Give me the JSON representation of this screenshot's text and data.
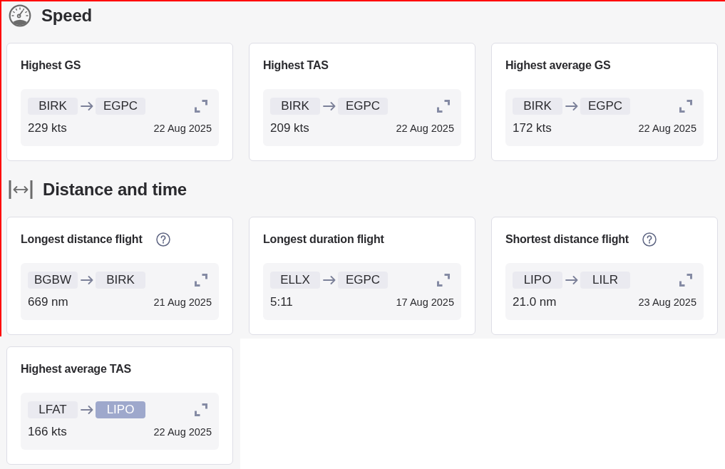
{
  "sections": [
    {
      "kind": "speed",
      "title": "Speed",
      "cards": [
        {
          "title": "Highest GS",
          "help": false,
          "route": [
            {
              "code": "BIRK",
              "highlighted": false
            },
            {
              "code": "EGPC",
              "highlighted": false
            }
          ],
          "value": "229 kts",
          "date": "22 Aug 2025"
        },
        {
          "title": "Highest TAS",
          "help": false,
          "route": [
            {
              "code": "BIRK",
              "highlighted": false
            },
            {
              "code": "EGPC",
              "highlighted": false
            }
          ],
          "value": "209 kts",
          "date": "22 Aug 2025"
        },
        {
          "title": "Highest average GS",
          "help": false,
          "route": [
            {
              "code": "BIRK",
              "highlighted": false
            },
            {
              "code": "EGPC",
              "highlighted": false
            }
          ],
          "value": "172 kts",
          "date": "22 Aug 2025"
        }
      ]
    },
    {
      "kind": "distance",
      "title": "Distance and time",
      "cards": [
        {
          "title": "Longest distance flight",
          "help": true,
          "route": [
            {
              "code": "BGBW",
              "highlighted": false
            },
            {
              "code": "BIRK",
              "highlighted": false
            }
          ],
          "value": "669 nm",
          "date": "21 Aug 2025"
        },
        {
          "title": "Longest duration flight",
          "help": false,
          "route": [
            {
              "code": "ELLX",
              "highlighted": false
            },
            {
              "code": "EGPC",
              "highlighted": false
            }
          ],
          "value": "5:11",
          "date": "17 Aug 2025"
        },
        {
          "title": "Shortest distance flight",
          "help": true,
          "route": [
            {
              "code": "LIPO",
              "highlighted": false
            },
            {
              "code": "LILR",
              "highlighted": false
            }
          ],
          "value": "21.0 nm",
          "date": "23 Aug 2025"
        },
        {
          "title": "Highest average TAS",
          "help": false,
          "route": [
            {
              "code": "LFAT",
              "highlighted": false
            },
            {
              "code": "LIPO",
              "highlighted": true
            }
          ],
          "value": "166 kts",
          "date": "22 Aug 2025"
        }
      ]
    }
  ]
}
